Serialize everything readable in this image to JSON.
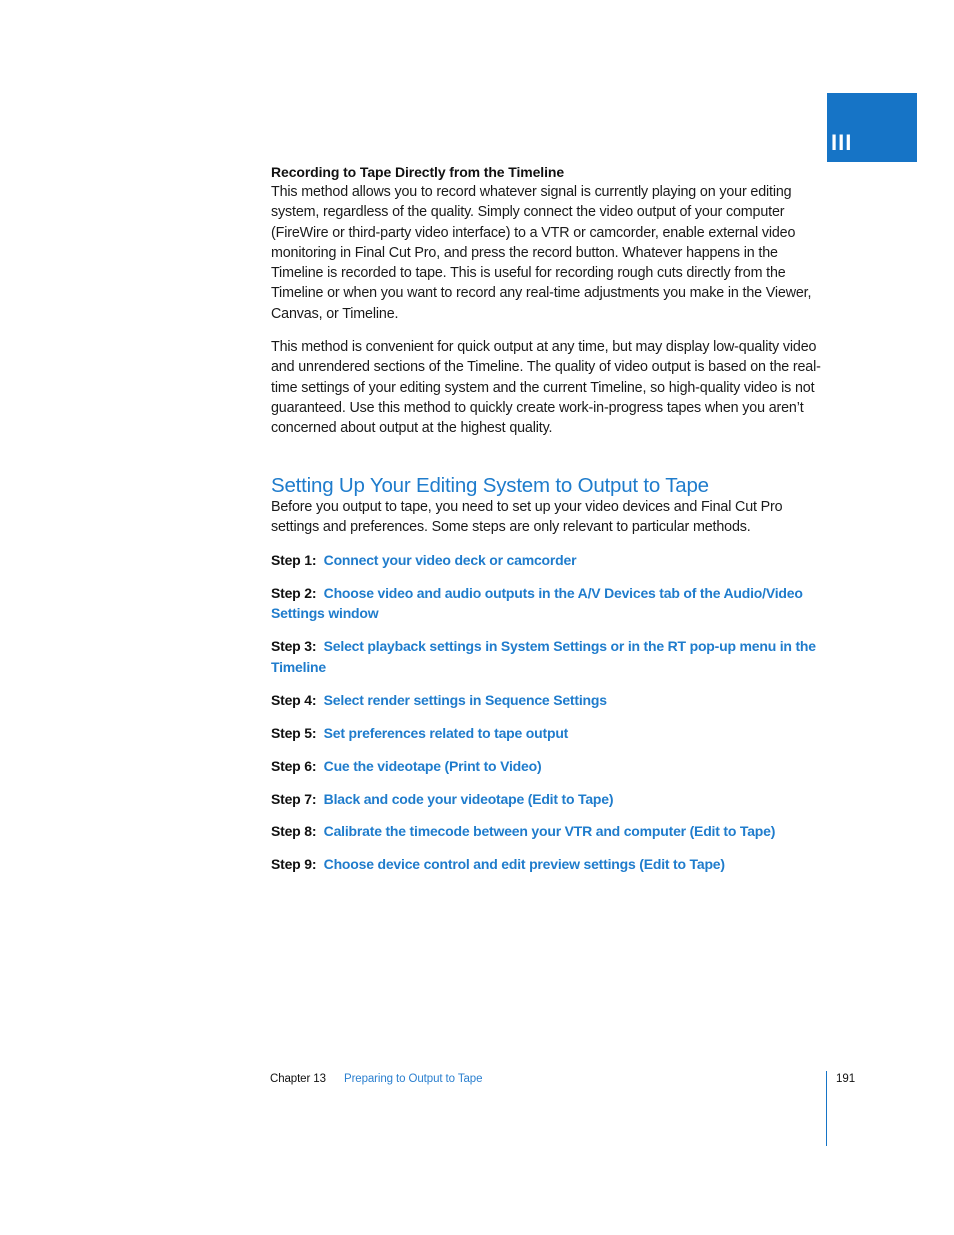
{
  "part_tab": {
    "label": "III",
    "color": "#1674c6"
  },
  "recording_section": {
    "heading": "Recording to Tape Directly from the Timeline",
    "paragraphs": [
      "This method allows you to record whatever signal is currently playing on your editing system, regardless of the quality. Simply connect the video output of your computer (FireWire or third-party video interface) to a VTR or camcorder, enable external video monitoring in Final Cut Pro, and press the record button. Whatever happens in the Timeline is recorded to tape. This is useful for recording rough cuts directly from the Timeline or when you want to record any real-time adjustments you make in the Viewer, Canvas, or Timeline.",
      "This method is convenient for quick output at any time, but may display low-quality video and unrendered sections of the Timeline. The quality of video output is based on the real-time settings of your editing system and the current Timeline, so high-quality video is not guaranteed. Use this method to quickly create work-in-progress tapes when you aren’t concerned about output at the highest quality."
    ]
  },
  "setup_section": {
    "title": "Setting Up Your Editing System to Output to Tape",
    "title_color": "#1f7ccc",
    "intro": "Before you output to tape, you need to set up your video devices and Final Cut Pro settings and preferences. Some steps are only relevant to particular methods.",
    "steps": [
      {
        "label": "Step 1:",
        "text": "Connect your video deck or camcorder"
      },
      {
        "label": "Step 2:",
        "text": "Choose video and audio outputs in the A/V Devices tab of the Audio/Video Settings window"
      },
      {
        "label": "Step 3:",
        "text": "Select playback settings in System Settings or in the RT pop-up menu in the Timeline"
      },
      {
        "label": "Step 4:",
        "text": "Select render settings in Sequence Settings"
      },
      {
        "label": "Step 5:",
        "text": "Set preferences related to tape output"
      },
      {
        "label": "Step 6:",
        "text": "Cue the videotape (Print to Video)"
      },
      {
        "label": "Step 7:",
        "text": "Black and code your videotape (Edit to Tape)"
      },
      {
        "label": "Step 8:",
        "text": "Calibrate the timecode between your VTR and computer (Edit to Tape)"
      },
      {
        "label": "Step 9:",
        "text": "Choose device control and edit preview settings (Edit to Tape)"
      }
    ]
  },
  "footer": {
    "chapter": "Chapter 13",
    "chapter_title": "Preparing to Output to Tape",
    "page_number": "191"
  }
}
